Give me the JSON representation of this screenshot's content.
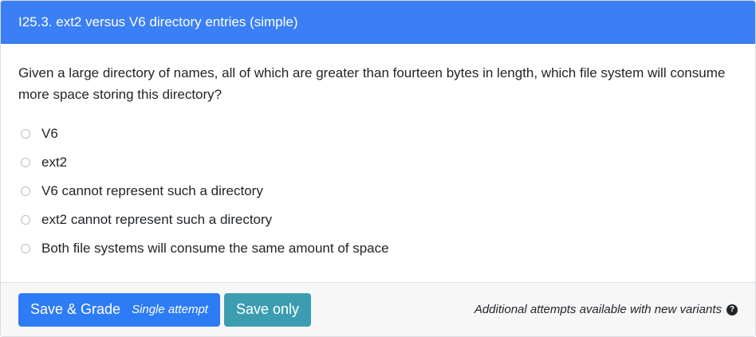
{
  "header": {
    "title": "I25.3. ext2 versus V6 directory entries (simple)"
  },
  "question": {
    "text": "Given a large directory of names, all of which are greater than fourteen bytes in length, which file system will consume more space storing this directory?",
    "options": [
      {
        "label": "V6"
      },
      {
        "label": "ext2"
      },
      {
        "label": "V6 cannot represent such a directory"
      },
      {
        "label": "ext2 cannot represent such a directory"
      },
      {
        "label": "Both file systems will consume the same amount of space"
      }
    ]
  },
  "footer": {
    "save_grade_label": "Save & Grade",
    "save_grade_sub": "Single attempt",
    "save_only_label": "Save only",
    "note": "Additional attempts available with new variants",
    "help_icon": "question-circle-icon"
  },
  "colors": {
    "header_bg": "#3a7ff5",
    "primary_button": "#2e7bf6",
    "info_button": "#3d9db0",
    "footer_bg": "#f7f7f8"
  }
}
